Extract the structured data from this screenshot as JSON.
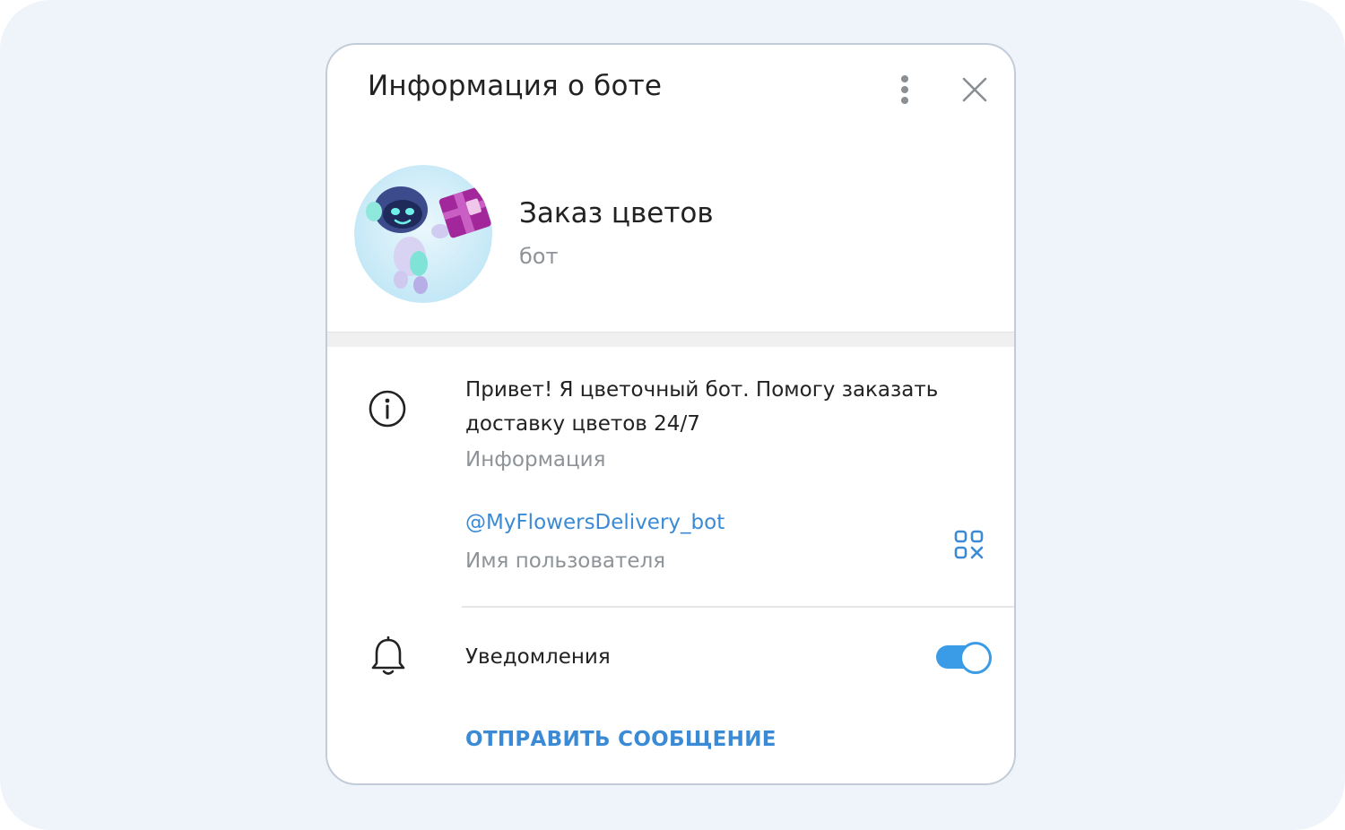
{
  "dialog": {
    "title": "Информация о боте",
    "more_icon": "more-vertical-icon",
    "close_icon": "close-icon"
  },
  "profile": {
    "name": "Заказ цветов",
    "subtitle": "бот",
    "avatar": "robot-with-gift-avatar"
  },
  "info": {
    "icon": "info-icon",
    "text": "Привет! Я цветочный бот. Помогу заказать доставку цветов 24/7",
    "label": "Информация"
  },
  "username": {
    "value": "@MyFlowersDelivery_bot",
    "label": "Имя пользователя",
    "qr_icon": "qr-code-icon"
  },
  "notifications": {
    "icon": "bell-icon",
    "label": "Уведомления",
    "enabled": true
  },
  "actions": {
    "send_message": "ОТПРАВИТЬ СООБЩЕНИЕ"
  },
  "colors": {
    "accent": "#3a8ad6",
    "toggle": "#3a9be6",
    "backdrop": "#eff4fb"
  }
}
